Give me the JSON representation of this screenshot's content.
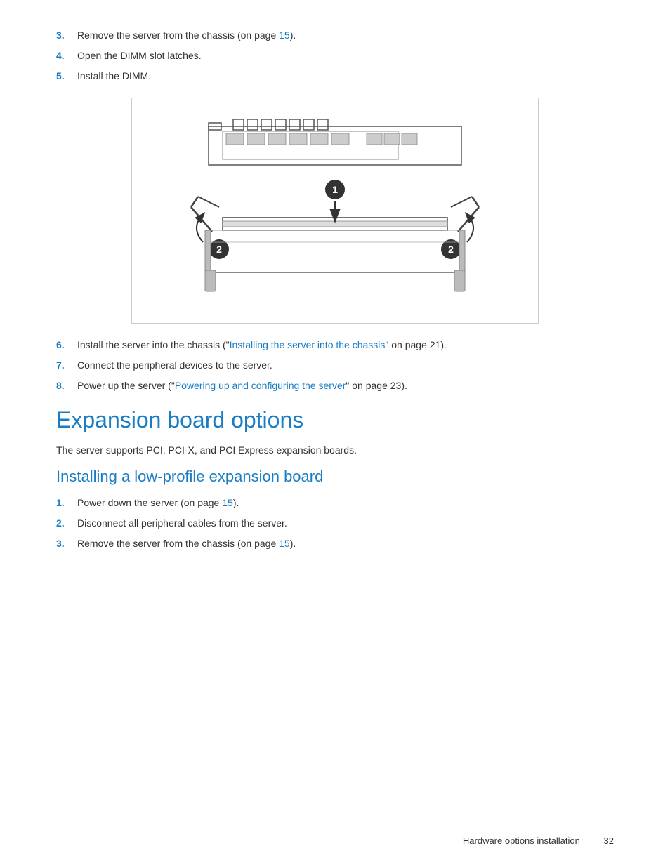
{
  "steps_top": [
    {
      "num": "3.",
      "text": "Remove the server from the chassis (on page ",
      "link_text": "15",
      "link_href": "#",
      "text_after": ")."
    },
    {
      "num": "4.",
      "text": "Open the DIMM slot latches.",
      "link_text": null
    },
    {
      "num": "5.",
      "text": "Install the DIMM.",
      "link_text": null
    }
  ],
  "steps_bottom": [
    {
      "num": "6.",
      "text": "Install the server into the chassis (\"",
      "link_text": "Installing the server into the chassis",
      "link_href": "#",
      "text_after": "\" on page 21)."
    },
    {
      "num": "7.",
      "text": "Connect the peripheral devices to the server.",
      "link_text": null
    },
    {
      "num": "8.",
      "text": "Power up the server (\"",
      "link_text": "Powering up and configuring the server",
      "link_href": "#",
      "text_after": "\" on page 23)."
    }
  ],
  "section_title": "Expansion board options",
  "section_body": "The server supports PCI, PCI-X, and PCI Express expansion boards.",
  "subsection_title": "Installing a low-profile expansion board",
  "steps_lowprofile": [
    {
      "num": "1.",
      "text": "Power down the server (on page ",
      "link_text": "15",
      "link_href": "#",
      "text_after": ")."
    },
    {
      "num": "2.",
      "text": "Disconnect all peripheral cables from the server.",
      "link_text": null
    },
    {
      "num": "3.",
      "text": "Remove the server from the chassis (on page ",
      "link_text": "15",
      "link_href": "#",
      "text_after": ")."
    }
  ],
  "footer_text": "Hardware options installation",
  "footer_page": "32"
}
